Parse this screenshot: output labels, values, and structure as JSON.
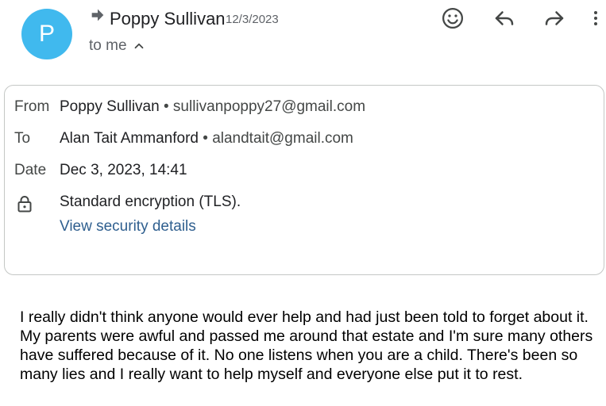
{
  "sender": {
    "avatar_letter": "P",
    "name": "Poppy Sullivan",
    "date": "12/3/2023",
    "to_me": "to me"
  },
  "toolbar": {
    "icons": [
      "emoji-icon",
      "reply-icon",
      "forward-icon",
      "more-vert-icon"
    ]
  },
  "details": {
    "from_label": "From",
    "from_name": "Poppy Sullivan",
    "from_email": "sullivanpoppy27@gmail.com",
    "to_label": "To",
    "to_name": "Alan Tait Ammanford",
    "to_email": "alandtait@gmail.com",
    "date_label": "Date",
    "date_value": "Dec 3, 2023, 14:41",
    "encryption": "Standard encryption (TLS).",
    "security_link": "View security details"
  },
  "message": {
    "body": "I really didn't think anyone would ever help and had just been told to forget about it. My parents were awful and passed me around that estate and I'm sure many others have suffered because of it. No one listens when you are a child. There's been so many lies and I really want to help myself and everyone else put it to rest."
  },
  "colors": {
    "avatar": "#40b9ee",
    "link": "#2f5f8f",
    "border": "#c4c7c5"
  }
}
